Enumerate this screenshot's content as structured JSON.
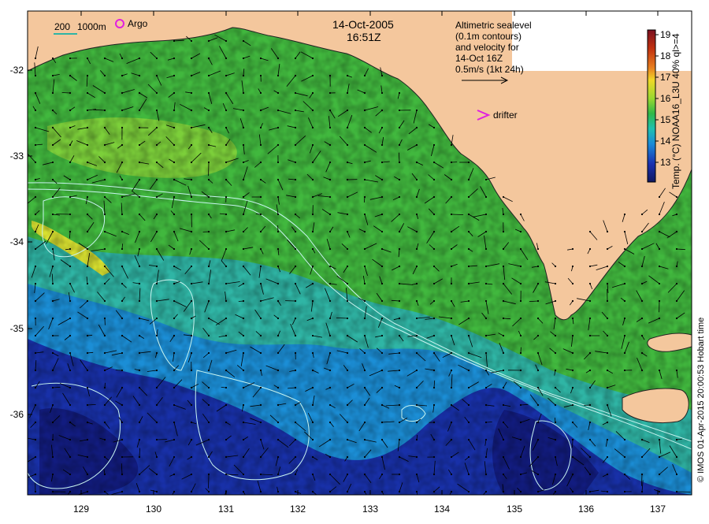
{
  "map": {
    "date": "14-Oct-2005",
    "time": "16:51Z",
    "legend": {
      "scale_label": "200",
      "depth_label": "1000m",
      "argo_label": "Argo",
      "drifter_label": "drifter"
    },
    "altimetry_note": [
      "Altimetric sealevel",
      "(0.1m contours)",
      "and velocity for",
      "14-Oct 16Z",
      "0.5m/s (1kt 24h)"
    ],
    "x_ticks": [
      "129",
      "130",
      "131",
      "132",
      "133",
      "134",
      "135",
      "136",
      "137"
    ],
    "y_ticks": [
      "-32",
      "-33",
      "-34",
      "-35",
      "-36"
    ],
    "colorbar": {
      "label": "Temp. (°C) NOAA16_L3U 40% ql>=4",
      "ticks": [
        "19",
        "18",
        "17",
        "16",
        "15",
        "14",
        "13"
      ],
      "stops": [
        "#7a1020",
        "#c03010",
        "#e88020",
        "#f0d828",
        "#9ad830",
        "#30b848",
        "#20c0b0",
        "#1a8ad8",
        "#1a30b0",
        "#101860"
      ]
    },
    "credit": "© IMOS 01-Apr-2015 20:00:53 Hobart time",
    "colors": {
      "land": "#f4c79d",
      "ocean_warm": "#41b83e",
      "ocean_mid": "#2fb5a5",
      "ocean_cool": "#1b8ed6",
      "ocean_cold": "#1830a8",
      "argo": "#e020e0",
      "drifter": "#e020e0",
      "contour": "#c8f4f0"
    }
  }
}
